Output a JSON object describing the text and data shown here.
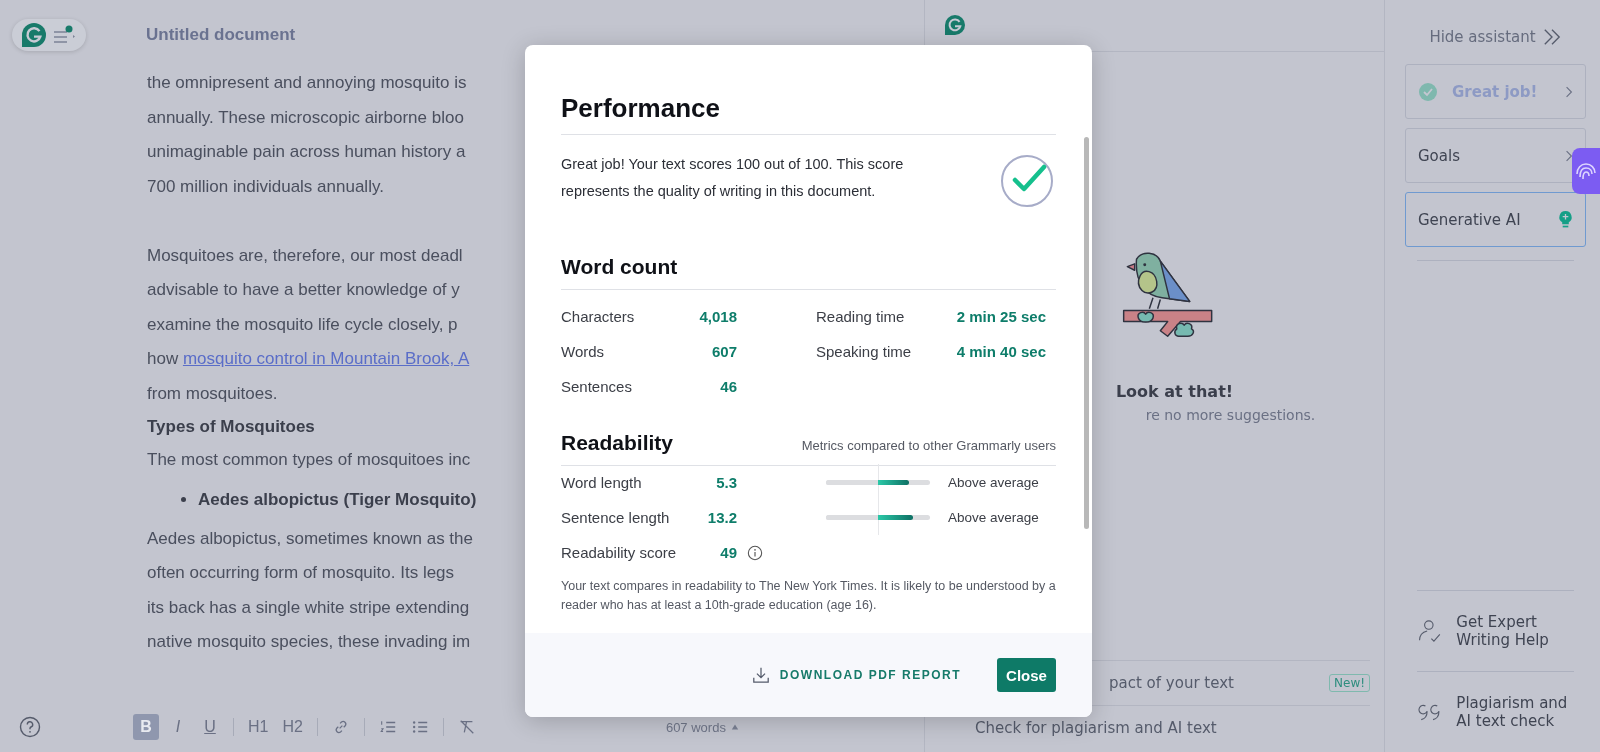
{
  "document": {
    "title": "Untitled document",
    "blocks": [
      {
        "kind": "paragraph",
        "lines": [
          {
            "text": "the omnipresent and annoying mosquito is"
          },
          {
            "text": "annually. These microscopic airborne bloo"
          },
          {
            "text": "unimaginable pain across human history a"
          },
          {
            "text": "700 million individuals annually."
          }
        ]
      },
      {
        "kind": "blank"
      },
      {
        "kind": "paragraph",
        "lines": [
          {
            "text": "Mosquitoes are, therefore, our most deadl"
          },
          {
            "text": "advisable to have a better knowledge of y"
          },
          {
            "text": "examine the mosquito life cycle closely, p"
          },
          {
            "text": "how ",
            "link": "mosquito control in Mountain Brook, A"
          },
          {
            "text": "from mosquitoes."
          }
        ]
      },
      {
        "kind": "heading",
        "text": "Types of Mosquitoes"
      },
      {
        "kind": "paragraph",
        "lines": [
          {
            "text": "The most common types of mosquitoes inc"
          }
        ]
      },
      {
        "kind": "bullet",
        "text": "Aedes albopictus (Tiger Mosquito)"
      },
      {
        "kind": "paragraph",
        "lines": [
          {
            "text": "Aedes albopictus, sometimes known as the"
          },
          {
            "text": "often occurring form of mosquito. Its legs"
          },
          {
            "text": "its back has a single white stripe extending"
          },
          {
            "text": "native mosquito species, these invading im"
          }
        ]
      }
    ]
  },
  "toolbar": {
    "tools": [
      {
        "kind": "bold",
        "label": "B",
        "selected": true
      },
      {
        "kind": "italic",
        "label": "I",
        "selected": false
      },
      {
        "kind": "underline",
        "label": "U",
        "selected": false
      },
      {
        "kind": "heading",
        "label": "H1",
        "selected": false
      },
      {
        "kind": "heading",
        "label": "H2",
        "selected": false
      },
      {
        "kind": "link",
        "selected": false
      },
      {
        "kind": "numbered_list",
        "selected": false
      },
      {
        "kind": "bullet_list",
        "selected": false
      },
      {
        "kind": "clear_format",
        "selected": false
      }
    ],
    "word_count": "607 words"
  },
  "suggestions": {
    "title": "Look at that!",
    "message": "re no more suggestions.",
    "actions": [
      {
        "text": "pact of your text",
        "badge": "New!"
      },
      {
        "text": "Check for plagiarism and AI text"
      }
    ]
  },
  "sidebar": {
    "hide_label": "Hide assistant",
    "cards": [
      {
        "kind": "score",
        "label": "Great job!",
        "selected": false
      },
      {
        "kind": "goals",
        "label": "Goals",
        "selected": false
      },
      {
        "kind": "ai",
        "label": "Generative AI",
        "selected": true
      }
    ],
    "links": [
      {
        "kind": "expert",
        "label": "Get Expert Writing Help"
      },
      {
        "kind": "plagiarism",
        "label": "Plagiarism and AI text check"
      }
    ]
  },
  "modal": {
    "title": "Performance",
    "summary": "Great job! Your text scores 100 out of 100. This score represents the quality of writing in this document.",
    "word_count": {
      "title": "Word count",
      "rows": [
        {
          "label": "Characters",
          "value": "4,018",
          "label_2": "Reading time",
          "value_2": "2 min 25 sec"
        },
        {
          "label": "Words",
          "value": "607",
          "label_2": "Speaking time",
          "value_2": "4 min 40 sec"
        },
        {
          "label": "Sentences",
          "value": "46"
        }
      ]
    },
    "readability": {
      "title": "Readability",
      "note": "Metrics compared to other Grammarly users",
      "metrics": [
        {
          "kind": "bar",
          "label": "Word length",
          "value": "5.3",
          "level": 0.8,
          "rating": "Above average"
        },
        {
          "kind": "bar",
          "label": "Sentence length",
          "value": "13.2",
          "level": 0.84,
          "rating": "Above average"
        },
        {
          "kind": "info",
          "label": "Readability score",
          "value": "49"
        }
      ],
      "description": "Your text compares in readability to The New York Times. It is likely to be understood by a reader who has at least a 10th-grade education (age 16)."
    },
    "download": "DOWNLOAD PDF REPORT",
    "close": "Close"
  }
}
